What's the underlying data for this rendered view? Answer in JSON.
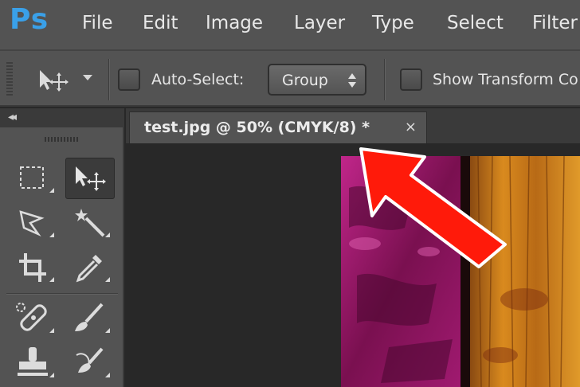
{
  "app": {
    "logo": "Ps"
  },
  "menu": {
    "items": [
      {
        "label": "File"
      },
      {
        "label": "Edit"
      },
      {
        "label": "Image"
      },
      {
        "label": "Layer"
      },
      {
        "label": "Type"
      },
      {
        "label": "Select"
      },
      {
        "label": "Filter"
      }
    ]
  },
  "options_bar": {
    "tool_icon": "move-tool-icon",
    "auto_select_label": "Auto-Select:",
    "auto_select_checked": false,
    "group_value": "Group",
    "show_transform_label": "Show Transform Co",
    "show_transform_checked": false
  },
  "tools_panel": {
    "collapse_label": "◂◂",
    "tools": [
      {
        "name": "rectangular-marquee-tool-icon",
        "active": false
      },
      {
        "name": "move-tool-icon",
        "active": true
      },
      {
        "name": "lasso-tool-icon",
        "active": false
      },
      {
        "name": "magic-wand-tool-icon",
        "active": false
      },
      {
        "name": "crop-tool-icon",
        "active": false
      },
      {
        "name": "eyedropper-tool-icon",
        "active": false
      },
      {
        "name": "spot-healing-brush-tool-icon",
        "active": false
      },
      {
        "name": "brush-tool-icon",
        "active": false
      },
      {
        "name": "clone-stamp-tool-icon",
        "active": false
      },
      {
        "name": "history-brush-tool-icon",
        "active": false
      }
    ]
  },
  "document": {
    "tab_title": "test.jpg @ 50% (CMYK/8) *",
    "close_glyph": "×"
  },
  "annotation": {
    "arrow_color": "#ff1a0a"
  },
  "colors": {
    "ui_panel": "#535353",
    "ui_dark": "#282828",
    "ps_blue": "#3aa0e8",
    "image_magenta": "#b0207a",
    "image_orange": "#d98a1e"
  }
}
